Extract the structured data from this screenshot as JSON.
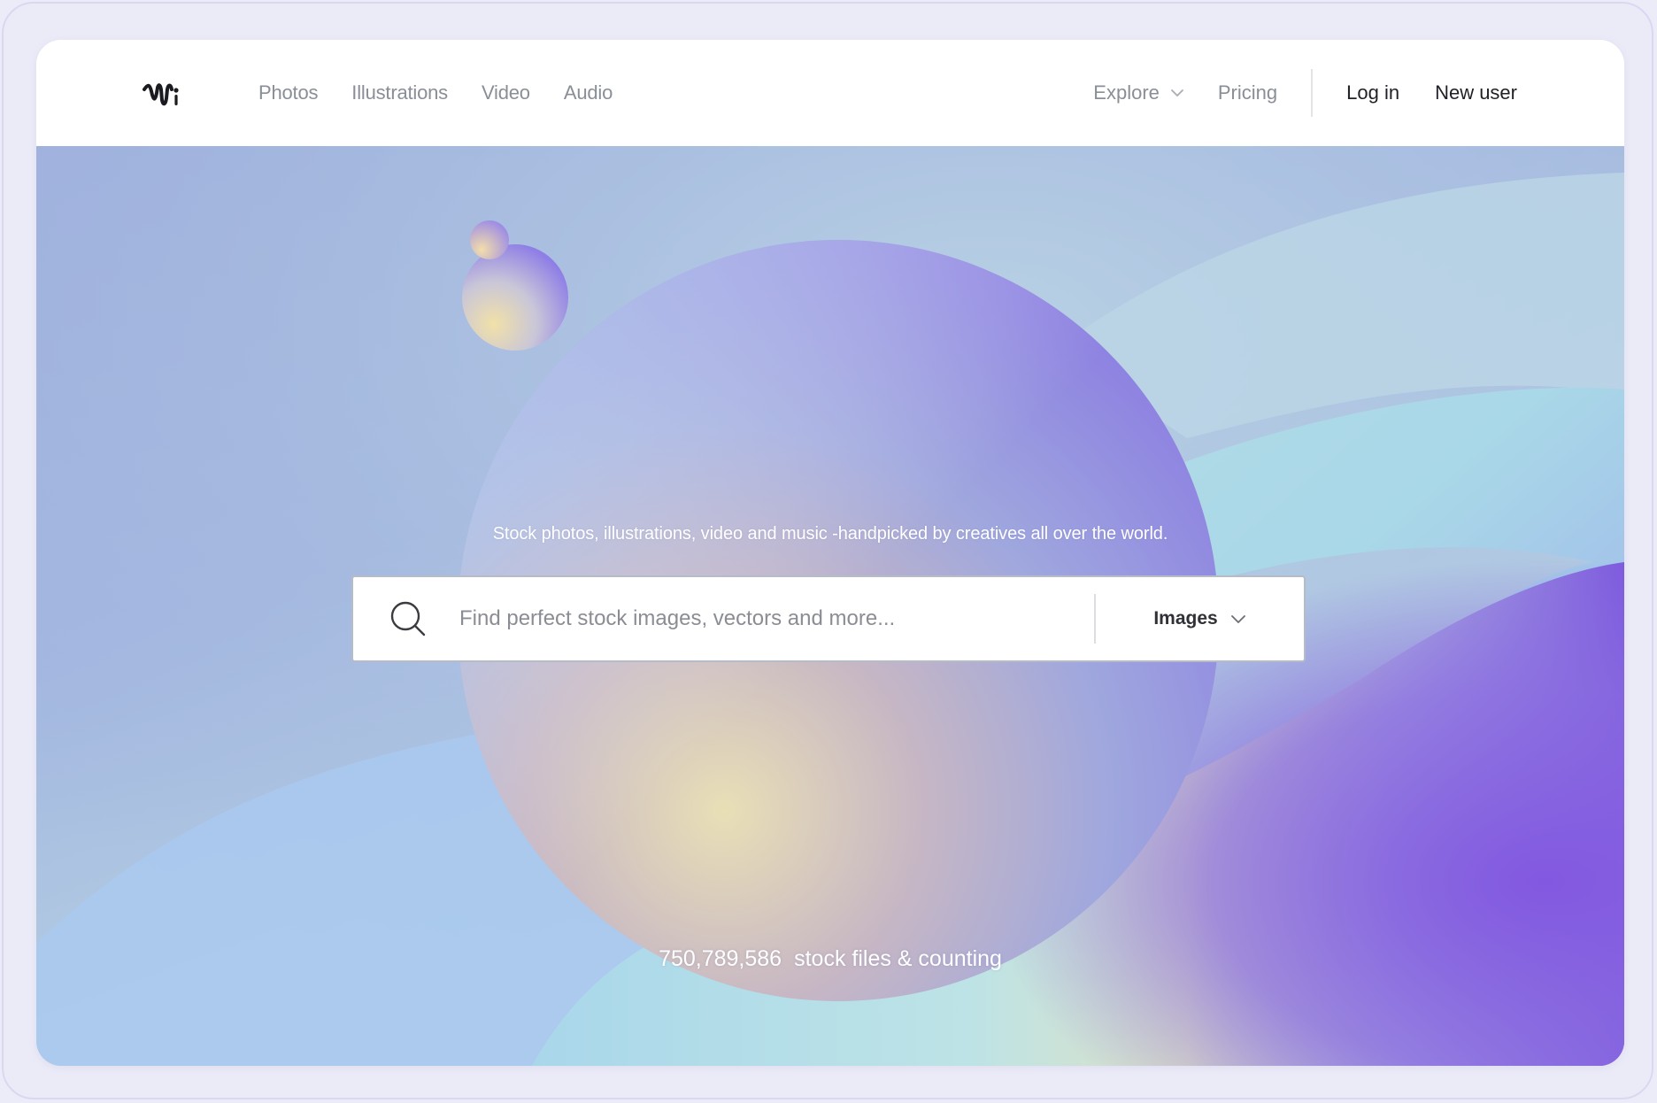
{
  "header": {
    "logo_name": "wavy-logo-icon",
    "nav_links": [
      "Photos",
      "Illustrations",
      "Video",
      "Audio"
    ],
    "explore_label": "Explore",
    "pricing_label": "Pricing",
    "login_label": "Log in",
    "new_user_label": "New user"
  },
  "hero": {
    "tagline": "Stock photos, illustrations, video and music -handpicked by creatives all over the world.",
    "search": {
      "placeholder": "Find perfect stock images, vectors and more...",
      "value": "",
      "type_selected": "Images"
    },
    "counter_number": "750,789,586",
    "counter_text": "stock files & counting"
  },
  "colors": {
    "text_muted": "#8a8e96",
    "text_dark": "#1f2126",
    "hero_purple": "#8a6fe0",
    "hero_blue": "#a3b7e0"
  }
}
